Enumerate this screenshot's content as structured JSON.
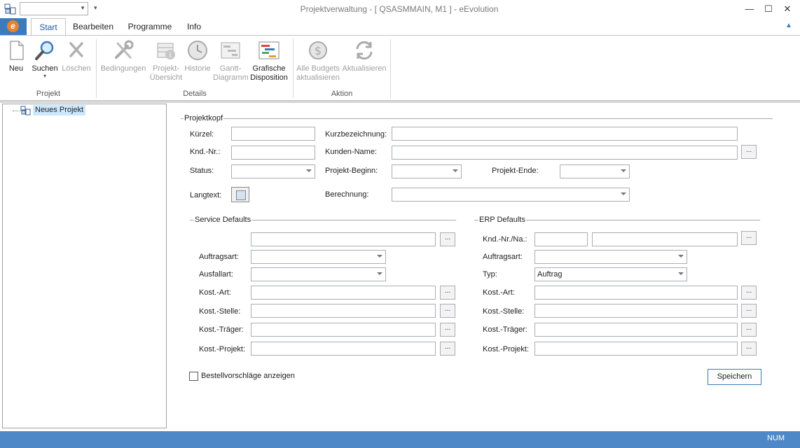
{
  "window": {
    "title": "Projektverwaltung - [ QSASMMAIN, M1 ]  -  eEvolution",
    "minimize": "—",
    "maximize": "☐",
    "close": "✕"
  },
  "ribbon": {
    "app_menu_letter": "e",
    "tabs": [
      {
        "label": "Start"
      },
      {
        "label": "Bearbeiten"
      },
      {
        "label": "Programme"
      },
      {
        "label": "Info"
      }
    ],
    "buttons": {
      "neu": "Neu",
      "suchen": "Suchen",
      "loeschen": "Löschen",
      "bedingungen": "Bedingungen",
      "projekt_uebersicht_1": "Projekt-",
      "projekt_uebersicht_2": "Übersicht",
      "historie": "Historie",
      "gantt_1": "Gantt-",
      "gantt_2": "Diagramm",
      "grafische_1": "Grafische",
      "grafische_2": "Disposition",
      "alle_budgets_1": "Alle Budgets",
      "alle_budgets_2": "aktualisieren",
      "aktualisieren": "Aktualisieren"
    },
    "groups": {
      "projekt": "Projekt",
      "details": "Details",
      "aktion": "Aktion"
    }
  },
  "tree": {
    "root_label": "Neues Projekt"
  },
  "form": {
    "projektkopf": {
      "title": "Projektkopf",
      "kuerzel": "Kürzel:",
      "kurzbezeichnung": "Kurzbezeichnung:",
      "knd_nr": "Knd.-Nr.:",
      "kunden_name": "Kunden-Name:",
      "status": "Status:",
      "projekt_beginn": "Projekt-Beginn:",
      "projekt_ende": "Projekt-Ende:",
      "langtext": "Langtext:",
      "berechnung": "Berechnung:"
    },
    "service_defaults": {
      "title": "Service Defaults",
      "auftragsart": "Auftragsart:",
      "ausfallart": "Ausfallart:",
      "kost_art": "Kost.-Art:",
      "kost_stelle": "Kost.-Stelle:",
      "kost_traeger": "Kost.-Träger:",
      "kost_projekt": "Kost.-Projekt:"
    },
    "erp_defaults": {
      "title": "ERP Defaults",
      "knd_nr_na": "Knd.-Nr./Na.:",
      "auftragsart": "Auftragsart:",
      "typ": "Typ:",
      "typ_value": "Auftrag",
      "kost_art": "Kost.-Art:",
      "kost_stelle": "Kost.-Stelle:",
      "kost_traeger": "Kost.-Träger:",
      "kost_projekt": "Kost.-Projekt:"
    },
    "dots": "...",
    "bestellvorschlaege": "Bestellvorschläge anzeigen",
    "speichern": "Speichern"
  },
  "statusbar": {
    "num": "NUM"
  },
  "colors": {
    "accent": "#3a7bbf",
    "statusbar": "#4f88c6",
    "selection": "#cce8ff"
  }
}
